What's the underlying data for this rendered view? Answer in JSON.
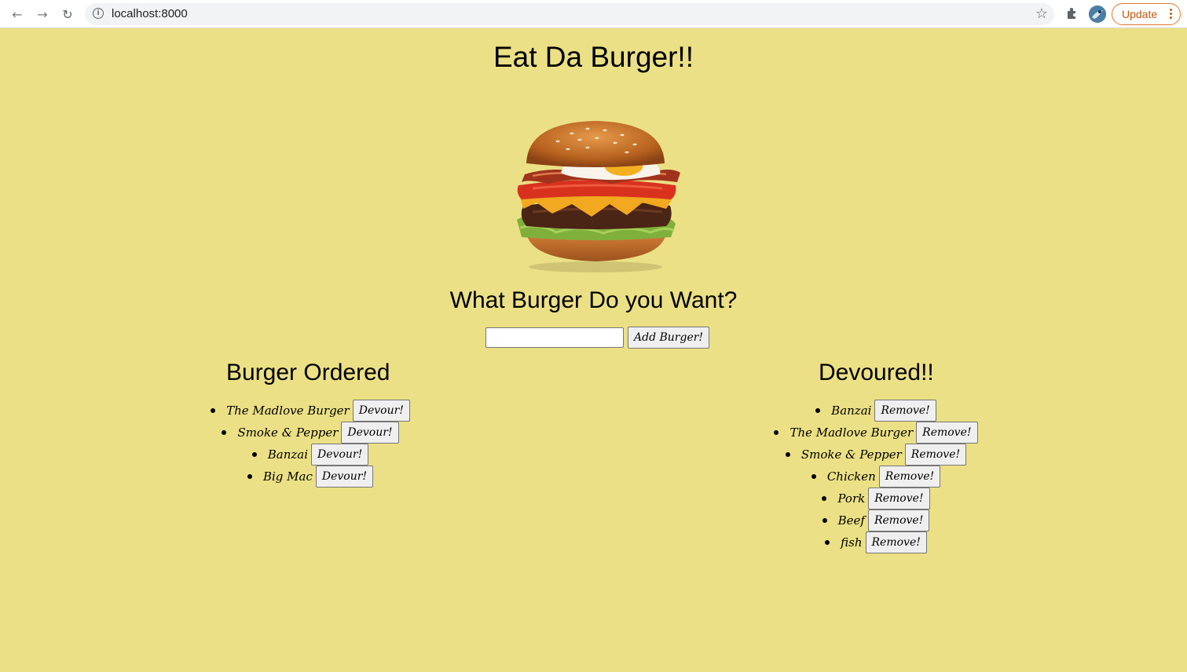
{
  "browser": {
    "url": "localhost:8000",
    "update_label": "Update"
  },
  "page": {
    "title": "Eat Da Burger!!",
    "subtitle": "What Burger Do you Want?",
    "add_button_label": "Add Burger!",
    "input_value": ""
  },
  "ordered": {
    "heading": "Burger Ordered",
    "button_label": "Devour!",
    "items": [
      {
        "name": "The Madlove Burger"
      },
      {
        "name": "Smoke & Pepper"
      },
      {
        "name": "Banzai"
      },
      {
        "name": "Big Mac"
      }
    ]
  },
  "devoured": {
    "heading": "Devoured!!",
    "button_label": "Remove!",
    "items": [
      {
        "name": "Banzai"
      },
      {
        "name": "The Madlove Burger"
      },
      {
        "name": "Smoke & Pepper"
      },
      {
        "name": "Chicken"
      },
      {
        "name": "Pork"
      },
      {
        "name": "Beef"
      },
      {
        "name": "fish"
      }
    ]
  }
}
